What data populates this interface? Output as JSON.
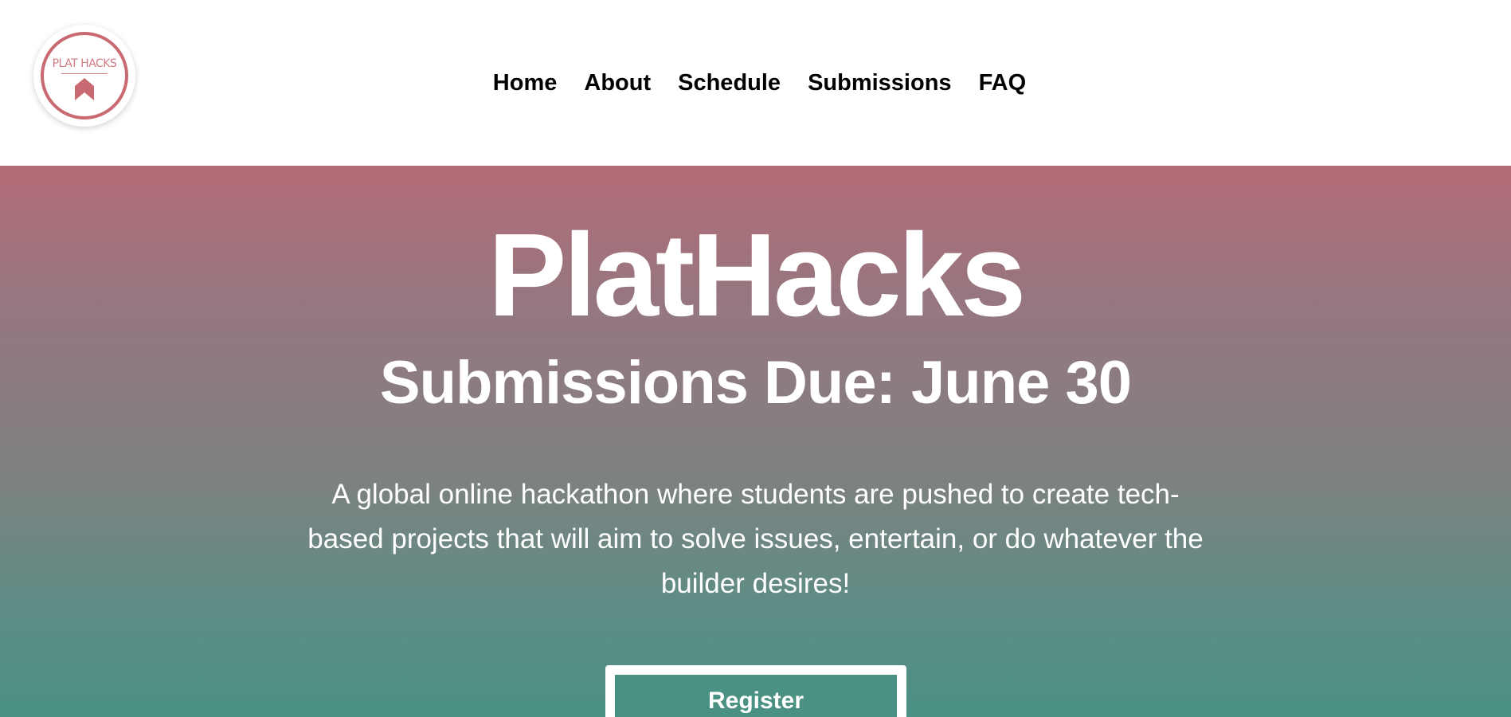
{
  "header": {
    "logo": {
      "text": "PLAT HACKS",
      "colors": {
        "ring": "#c96a72",
        "text": "#d07a82"
      }
    },
    "nav": [
      {
        "label": "Home"
      },
      {
        "label": "About"
      },
      {
        "label": "Schedule"
      },
      {
        "label": "Submissions"
      },
      {
        "label": "FAQ"
      }
    ]
  },
  "hero": {
    "title": "PlatHacks",
    "subtitle": "Submissions Due: June 30",
    "description": "A global online hackathon where students are pushed to create tech-based projects that will aim to solve issues, entertain, or do whatever the builder desires!",
    "register_label": "Register",
    "colors": {
      "gradient_top": "#b36b76",
      "gradient_bottom": "#4a9183",
      "button": "#4a9183"
    }
  }
}
